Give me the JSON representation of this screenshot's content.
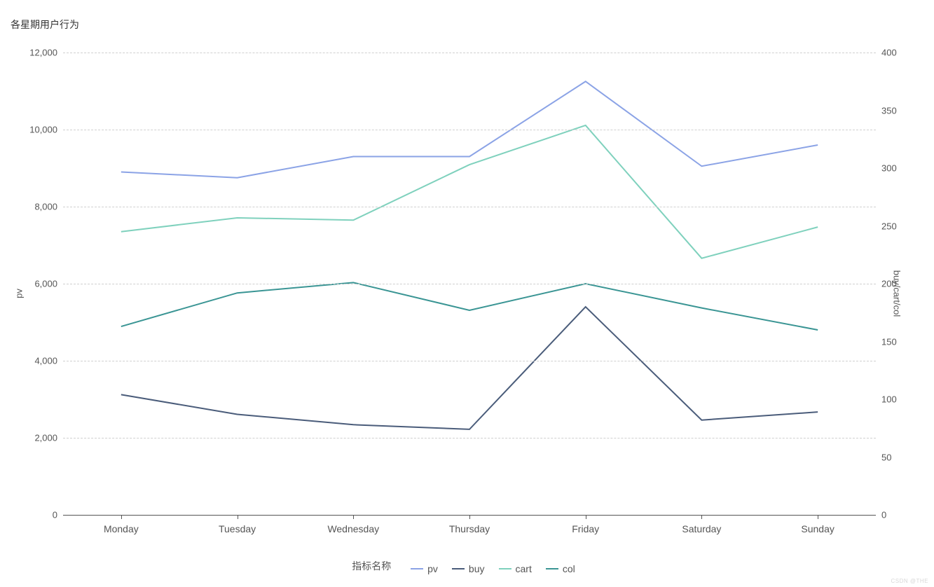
{
  "chart_data": {
    "type": "line",
    "title": "各星期用户行为",
    "categories": [
      "Monday",
      "Tuesday",
      "Wednesday",
      "Thursday",
      "Friday",
      "Saturday",
      "Sunday"
    ],
    "xlabel": "",
    "legend_title": "指标名称",
    "series": [
      {
        "name": "pv",
        "axis": "left",
        "color": "#8ba3e6",
        "values": [
          8900,
          8750,
          9300,
          9300,
          11250,
          9050,
          9600
        ]
      },
      {
        "name": "buy",
        "axis": "right",
        "color": "#4a5c7a",
        "values": [
          104,
          87,
          78,
          74,
          180,
          82,
          89
        ]
      },
      {
        "name": "cart",
        "axis": "right",
        "color": "#7fd1bd",
        "values": [
          245,
          257,
          255,
          303,
          337,
          222,
          249
        ]
      },
      {
        "name": "col",
        "axis": "right",
        "color": "#3a9594",
        "values": [
          163,
          192,
          201,
          177,
          200,
          179,
          160
        ]
      }
    ],
    "left_axis": {
      "label": "pv",
      "min": 0,
      "max": 12000,
      "ticks": [
        0,
        2000,
        4000,
        6000,
        8000,
        10000,
        12000
      ],
      "tick_labels": [
        "0",
        "2,000",
        "4,000",
        "6,000",
        "8,000",
        "10,000",
        "12,000"
      ]
    },
    "right_axis": {
      "label": "buy/cart/col",
      "min": 0,
      "max": 400,
      "ticks": [
        0,
        50,
        100,
        150,
        200,
        250,
        300,
        350,
        400
      ],
      "tick_labels": [
        "0",
        "50",
        "100",
        "150",
        "200",
        "250",
        "300",
        "350",
        "400"
      ]
    }
  },
  "watermark": "CSDN @THE"
}
